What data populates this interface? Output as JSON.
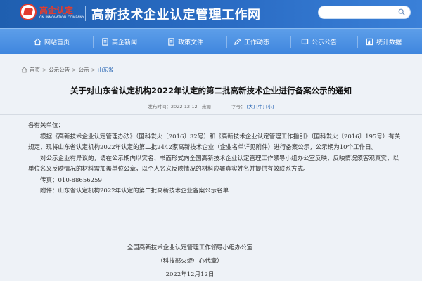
{
  "header": {
    "logo_cn": "高企认定",
    "logo_en": "CN INNOVATION COMPANY",
    "site_title": "高新技术企业认定管理工作网",
    "search_placeholder": ""
  },
  "nav": {
    "items": [
      {
        "label": "网站首页",
        "icon": "home-icon"
      },
      {
        "label": "高企新闻",
        "icon": "document-icon"
      },
      {
        "label": "政策文件",
        "icon": "document-icon"
      },
      {
        "label": "工作动态",
        "icon": "pencil-icon"
      },
      {
        "label": "公示公告",
        "icon": "announcement-icon"
      },
      {
        "label": "统计数据",
        "icon": "chart-icon"
      }
    ]
  },
  "breadcrumb": {
    "items": [
      "首页",
      "公示公告",
      "公示"
    ],
    "current": "山东省"
  },
  "article": {
    "title": "关于对山东省认定机构2022年认定的第二批高新技术企业进行备案公示的通知",
    "meta_date_label": "发布时间：",
    "meta_date": "2022-12-12",
    "meta_source": "来源：",
    "meta_size_label": "字号：",
    "size_large": "[大]",
    "size_medium": "[中]",
    "size_small": "[小]",
    "salutation": "各有关单位：",
    "para1": "根据《高新技术企业认定管理办法》（国科发火〔2016〕32号）和《高新技术企业认定管理工作指引》（国科发火〔2016〕195号）有关规定，现将山东省认定机构2022年认定的第二批2442家高新技术企业（企业名单详见附件）进行备案公示，公示期为10个工作日。",
    "para2": "对公示企业有异议的，请在公示期内以实名、书面形式向全国高新技术企业认定管理工作领导小组办公室反映，反映情况须客观真实，以单位名义反映情况的材料需加盖单位公章，以个人名义反映情况的材料应署真实姓名并提供有效联系方式。",
    "fax": "传真：010-88656259",
    "attachment": "附件：山东省认定机构2022年认定的第二批高新技术企业备案公示名单",
    "sign1": "全国高新技术企业认定管理工作领导小组办公室",
    "sign2": "（科技部火炬中心代章）",
    "sign_date": "2022年12月12日"
  },
  "colors": {
    "header_bg": "#2a6cc4",
    "nav_bg": "#4a8fe2",
    "logo_red": "#e63c2c",
    "link_blue": "#1f5fb0"
  }
}
